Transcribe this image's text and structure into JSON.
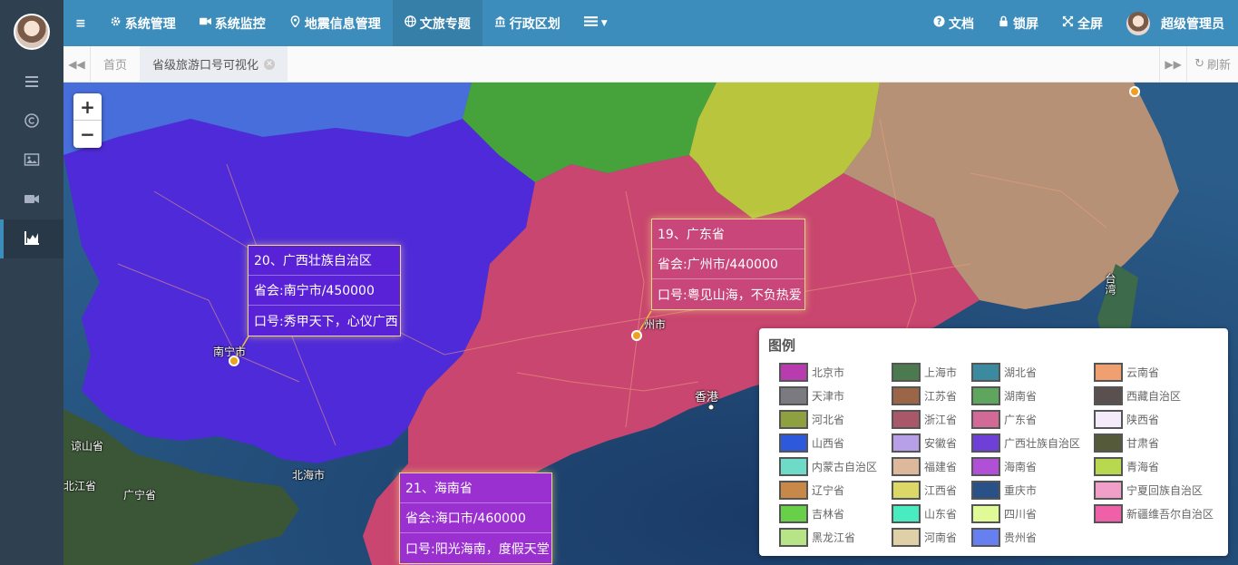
{
  "sidebar": {
    "items": [
      {
        "icon": "menu-icon"
      },
      {
        "icon": "copyright-icon"
      },
      {
        "icon": "image-icon"
      },
      {
        "icon": "video-icon"
      },
      {
        "icon": "chart-icon",
        "active": true
      }
    ]
  },
  "topbar": {
    "nav": [
      {
        "label": "≡",
        "icon": "hamburger-icon"
      },
      {
        "label": "系统管理",
        "icon": "gear-icon"
      },
      {
        "label": "系统监控",
        "icon": "video-camera-icon"
      },
      {
        "label": "地震信息管理",
        "icon": "map-pin-icon"
      },
      {
        "label": "文旅专题",
        "icon": "globe-icon",
        "active": true
      },
      {
        "label": "行政区划",
        "icon": "bank-icon"
      },
      {
        "label": "",
        "icon": "list-dropdown-icon"
      }
    ],
    "right": {
      "docs": "文档",
      "lock": "锁屏",
      "fullscreen": "全屏",
      "user": "超级管理员"
    }
  },
  "tabs": {
    "home": "首页",
    "active": "省级旅游口号可视化",
    "refresh": "刷新"
  },
  "map": {
    "zoom_in": "+",
    "zoom_out": "−",
    "popups": [
      {
        "title": "20、广西壮族自治区",
        "capital": "省会:南宁市/450000",
        "slogan": "口号:秀甲天下，心仪广西",
        "color": "#5a22d6"
      },
      {
        "title": "19、广东省",
        "capital": "省会:广州市/440000",
        "slogan": "口号:粤见山海，不负热爱",
        "color": "#c8467a"
      },
      {
        "title": "21、海南省",
        "capital": "省会:海口市/460000",
        "slogan": "口号:阳光海南，度假天堂",
        "color": "#9b30d0"
      }
    ],
    "labels": {
      "hk": "香港",
      "nanning": "南宁市",
      "guangzhou": "州市",
      "guangxi_sea": "广宁省",
      "beihai": "北海市",
      "liangshan": "谅山省",
      "beijiang": "北江省",
      "taiwan": "台湾"
    }
  },
  "legend": {
    "title": "图例",
    "entries": [
      {
        "name": "北京市",
        "color": "#b83cb0"
      },
      {
        "name": "上海市",
        "color": "#4a7a4e"
      },
      {
        "name": "湖北省",
        "color": "#3b8aa0"
      },
      {
        "name": "云南省",
        "color": "#f0a070"
      },
      {
        "name": "天津市",
        "color": "#7a7a80"
      },
      {
        "name": "江苏省",
        "color": "#9b6648"
      },
      {
        "name": "湖南省",
        "color": "#5ea55e"
      },
      {
        "name": "西藏自治区",
        "color": "#5a5050"
      },
      {
        "name": "河北省",
        "color": "#8fa040"
      },
      {
        "name": "浙江省",
        "color": "#a85868"
      },
      {
        "name": "广东省",
        "color": "#d26a98"
      },
      {
        "name": "陕西省",
        "color": "#f3eafa"
      },
      {
        "name": "山西省",
        "color": "#2d5adc"
      },
      {
        "name": "安徽省",
        "color": "#b7a0e8"
      },
      {
        "name": "广西壮族自治区",
        "color": "#6f40d8"
      },
      {
        "name": "甘肃省",
        "color": "#545a3a"
      },
      {
        "name": "内蒙古自治区",
        "color": "#6edac8"
      },
      {
        "name": "福建省",
        "color": "#ddb89a"
      },
      {
        "name": "海南省",
        "color": "#b050d6"
      },
      {
        "name": "青海省",
        "color": "#b8d850"
      },
      {
        "name": "辽宁省",
        "color": "#c88848"
      },
      {
        "name": "江西省",
        "color": "#dcd868"
      },
      {
        "name": "重庆市",
        "color": "#2a5088"
      },
      {
        "name": "宁夏回族自治区",
        "color": "#f0a0c8"
      },
      {
        "name": "吉林省",
        "color": "#68d048"
      },
      {
        "name": "山东省",
        "color": "#48ecc0"
      },
      {
        "name": "四川省",
        "color": "#e0fa98"
      },
      {
        "name": "新疆维吾尔自治区",
        "color": "#f060a8"
      },
      {
        "name": "黑龙江省",
        "color": "#b8e488"
      },
      {
        "name": "河南省",
        "color": "#dfd0a8"
      },
      {
        "name": "贵州省",
        "color": "#6680f0"
      }
    ]
  }
}
